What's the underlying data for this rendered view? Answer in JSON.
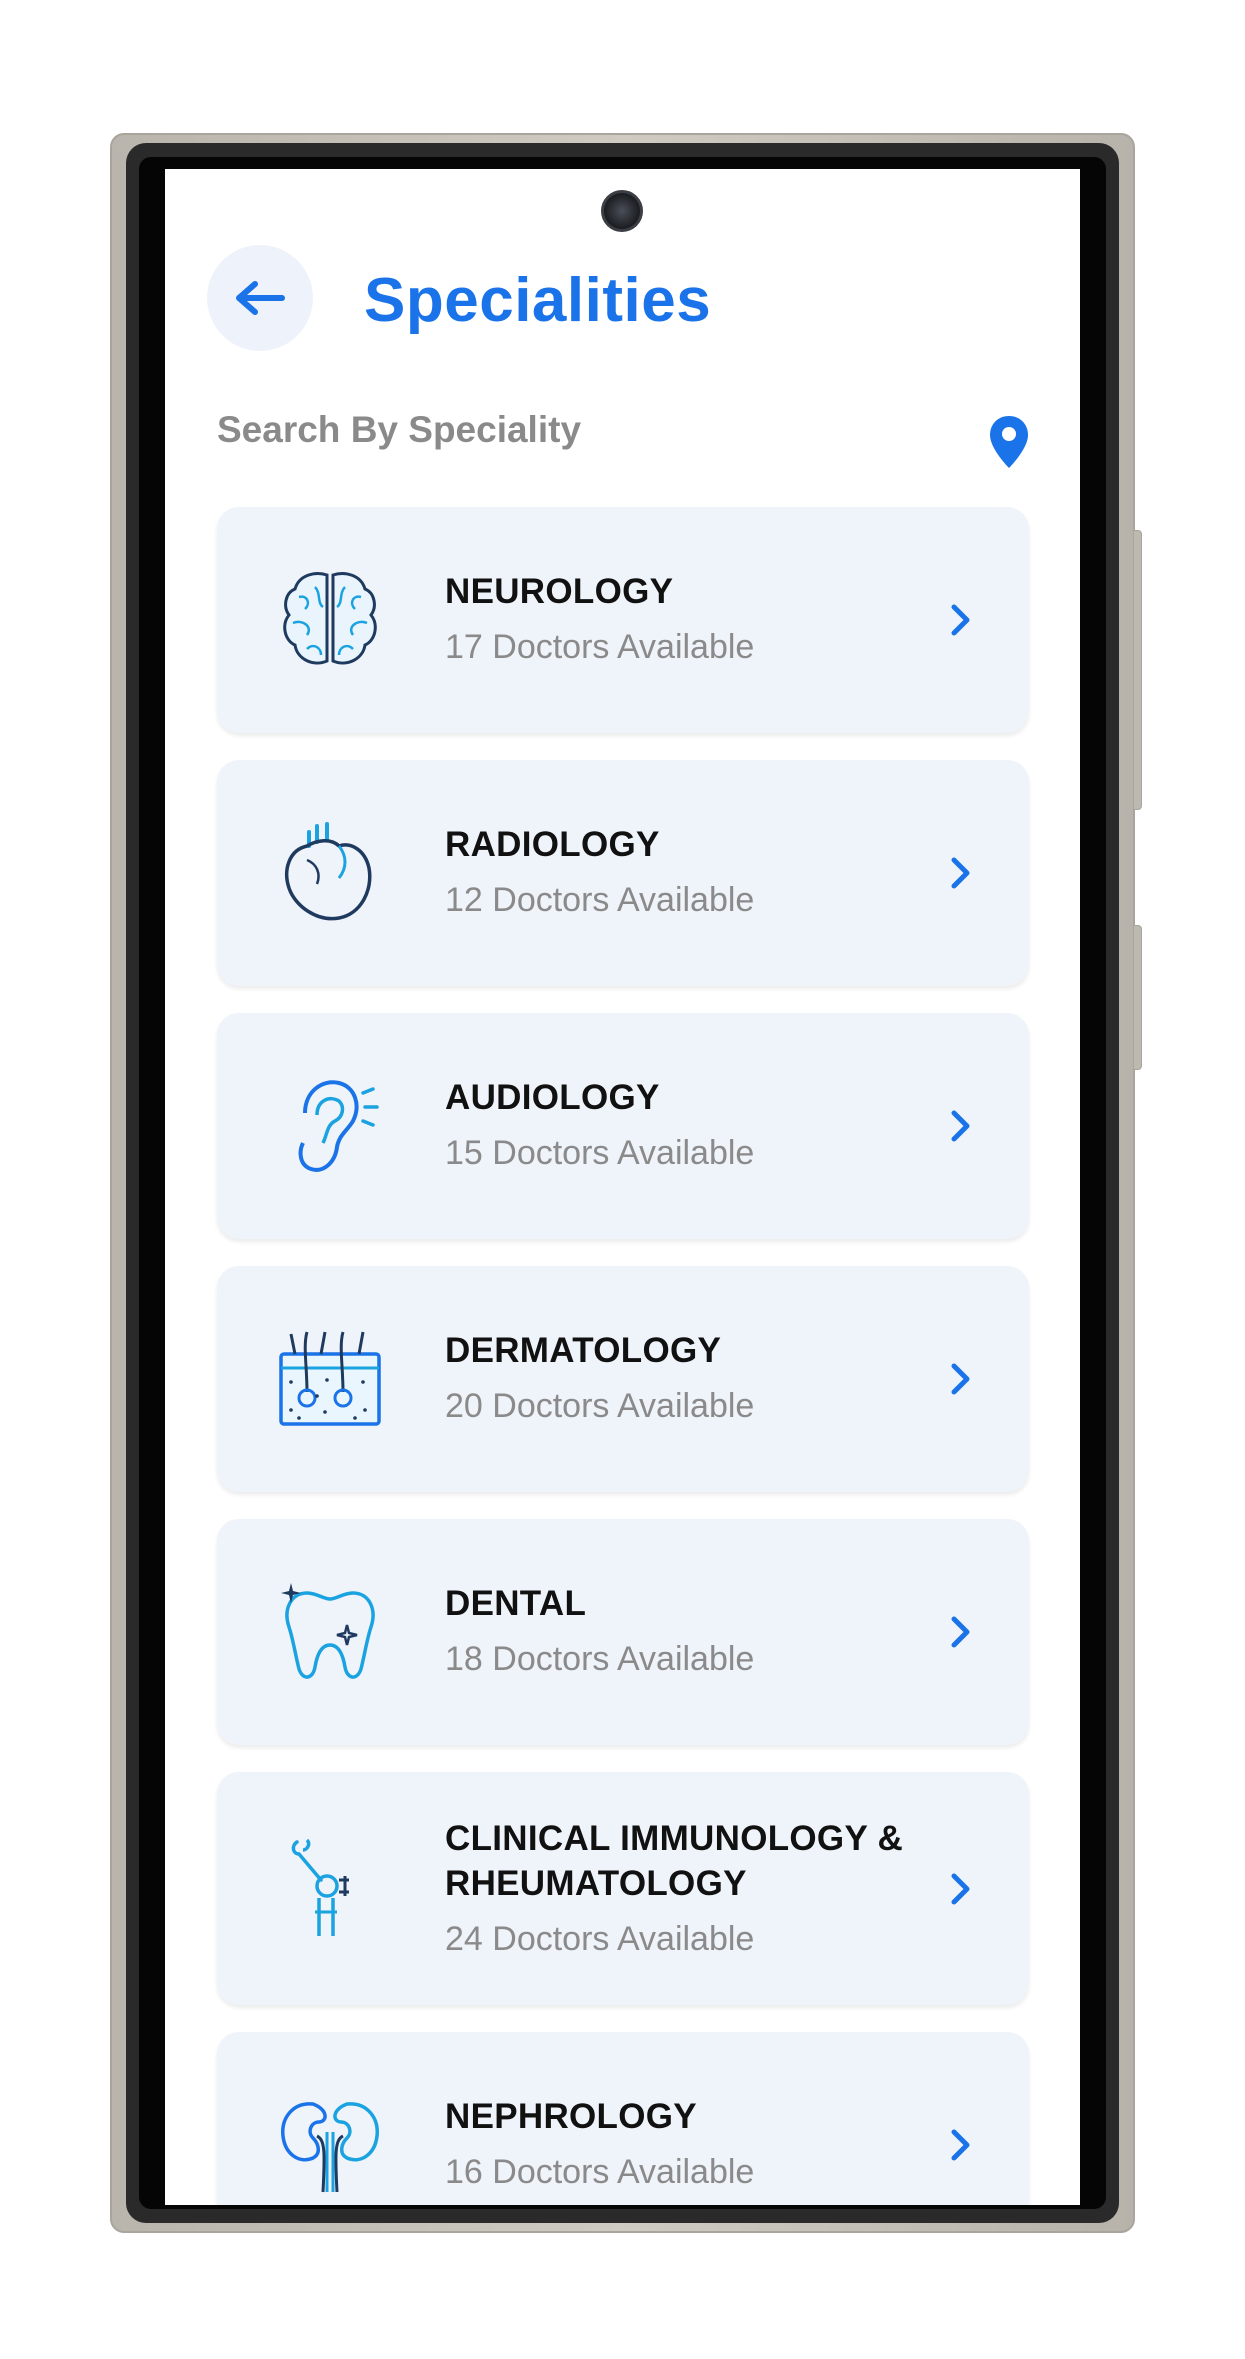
{
  "header": {
    "title": "Specialities"
  },
  "search": {
    "label": "Search By Speciality"
  },
  "icons": {
    "back": "arrow-left-icon",
    "location": "location-pin-icon",
    "chevron": "chevron-right-icon"
  },
  "colors": {
    "accent": "#1a73e8",
    "card_bg": "#eff3fa",
    "subtext": "#8a8a8a",
    "icon_dark": "#1f3a5f",
    "icon_light": "#1aa3e0"
  },
  "specialities": [
    {
      "name": "NEUROLOGY",
      "doctors": "17 Doctors Available",
      "icon": "brain-icon"
    },
    {
      "name": "RADIOLOGY",
      "doctors": "12 Doctors Available",
      "icon": "heart-icon"
    },
    {
      "name": "AUDIOLOGY",
      "doctors": "15 Doctors Available",
      "icon": "ear-icon"
    },
    {
      "name": "DERMATOLOGY",
      "doctors": "20 Doctors Available",
      "icon": "skin-icon"
    },
    {
      "name": "DENTAL",
      "doctors": "18 Doctors Available",
      "icon": "tooth-icon"
    },
    {
      "name": "CLINICAL IMMUNOLOGY & RHEUMATOLOGY",
      "doctors": "24 Doctors Available",
      "icon": "joint-icon"
    },
    {
      "name": "NEPHROLOGY",
      "doctors": "16 Doctors Available",
      "icon": "kidney-icon"
    }
  ]
}
